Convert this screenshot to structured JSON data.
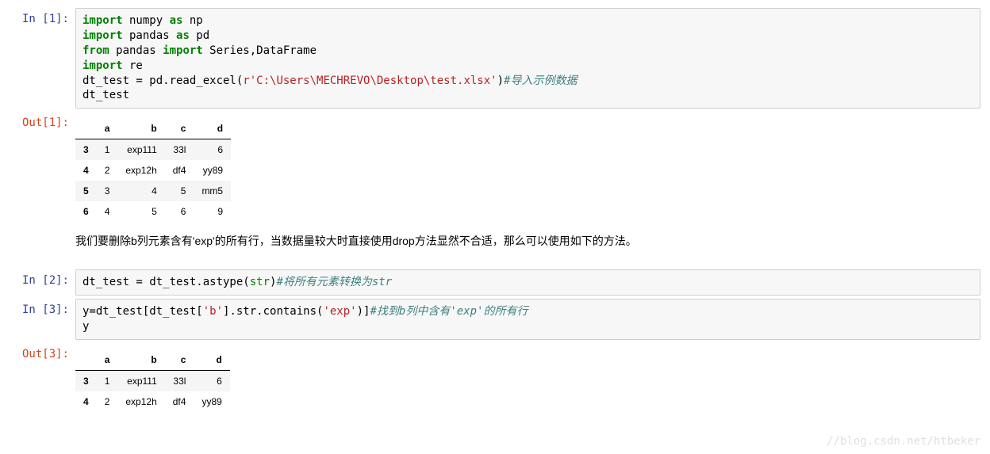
{
  "cells": {
    "in1_prompt": "In [1]:",
    "out1_prompt": "Out[1]:",
    "in2_prompt": "In [2]:",
    "in3_prompt": "In [3]:",
    "out3_prompt": "Out[3]:"
  },
  "code1": {
    "l1_kw1": "import",
    "l1_mod": " numpy ",
    "l1_kw2": "as",
    "l1_alias": " np",
    "l2_kw1": "import",
    "l2_mod": " pandas ",
    "l2_kw2": "as",
    "l2_alias": " pd",
    "l3_kw1": "from",
    "l3_mod": " pandas ",
    "l3_kw2": "import",
    "l3_names": " Series,DataFrame",
    "l4_kw1": "import",
    "l4_mod": " re",
    "l5_a": "dt_test = pd.read_excel(",
    "l5_b": "r'C:\\Users\\MECHREVO\\Desktop\\test.xlsx'",
    "l5_c": ")",
    "l5_comment": "#导入示例数据",
    "l6": "dt_test"
  },
  "table1": {
    "cols": [
      "",
      "a",
      "b",
      "c",
      "d"
    ],
    "rows": [
      {
        "idx": "3",
        "a": "1",
        "b": "exp111",
        "c": "33l",
        "d": "6"
      },
      {
        "idx": "4",
        "a": "2",
        "b": "exp12h",
        "c": "df4",
        "d": "yy89"
      },
      {
        "idx": "5",
        "a": "3",
        "b": "4",
        "c": "5",
        "d": "mm5"
      },
      {
        "idx": "6",
        "a": "4",
        "b": "5",
        "c": "6",
        "d": "9"
      }
    ]
  },
  "para1": "我们要删除b列元素含有'exp'的所有行，当数据量较大时直接使用drop方法显然不合适，那么可以使用如下的方法。",
  "code2": {
    "a": "dt_test = dt_test.astype(",
    "b": "str",
    "c": ")",
    "comment": "#将所有元素转换为str"
  },
  "code3": {
    "l1_a": "y=dt_test[dt_test[",
    "l1_b": "'b'",
    "l1_c": "].str.contains(",
    "l1_d": "'exp'",
    "l1_e": ")]",
    "l1_comment": "#找到b列中含有'exp'的所有行",
    "l2": "y"
  },
  "table2": {
    "cols": [
      "",
      "a",
      "b",
      "c",
      "d"
    ],
    "rows": [
      {
        "idx": "3",
        "a": "1",
        "b": "exp111",
        "c": "33l",
        "d": "6"
      },
      {
        "idx": "4",
        "a": "2",
        "b": "exp12h",
        "c": "df4",
        "d": "yy89"
      }
    ]
  },
  "watermark": "//blog.csdn.net/htbeker"
}
